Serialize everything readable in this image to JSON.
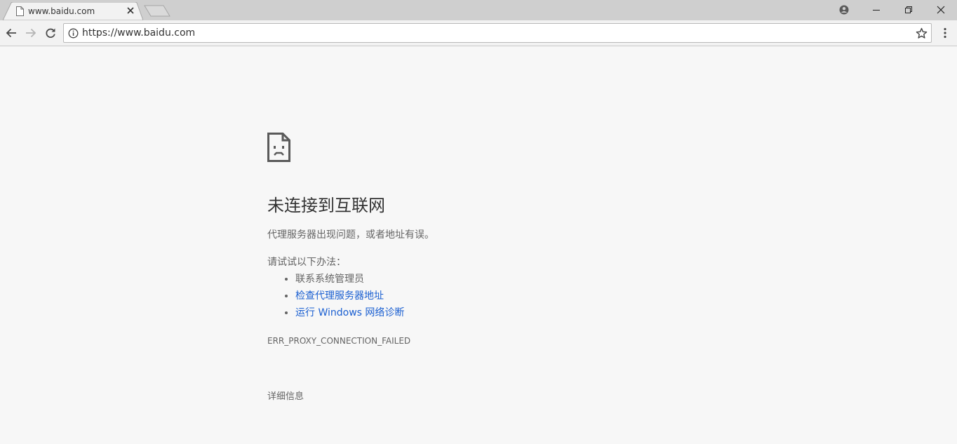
{
  "browser": {
    "tab": {
      "title": "www.baidu.com"
    },
    "address_bar": {
      "url": "https://www.baidu.com"
    }
  },
  "error_page": {
    "heading": "未连接到互联网",
    "description": "代理服务器出现问题，或者地址有误。",
    "suggestions_title": "请试试以下办法：",
    "suggestions": [
      {
        "label": "联系系统管理员",
        "is_link": false
      },
      {
        "label": "检查代理服务器地址",
        "is_link": true
      },
      {
        "label": "运行 Windows 网络诊断",
        "is_link": true
      }
    ],
    "error_code": "ERR_PROXY_CONNECTION_FAILED",
    "details_button": "详细信息"
  },
  "colors": {
    "page_bg": "#f7f7f7",
    "tabstrip_bg": "#cfcfcf",
    "link": "#1a5fd1",
    "heading": "#333333",
    "body_text": "#646464"
  },
  "icons": {
    "tab_favicon": "document-icon",
    "tab_close": "close-icon",
    "back": "arrow-left-icon",
    "forward": "arrow-right-icon",
    "reload": "reload-icon",
    "site_info": "info-icon",
    "bookmark": "star-icon",
    "menu": "kebab-menu-icon",
    "profile": "person-icon",
    "minimize": "minimize-icon",
    "restore": "restore-icon",
    "close_window": "close-icon",
    "error": "sad-document-icon"
  }
}
